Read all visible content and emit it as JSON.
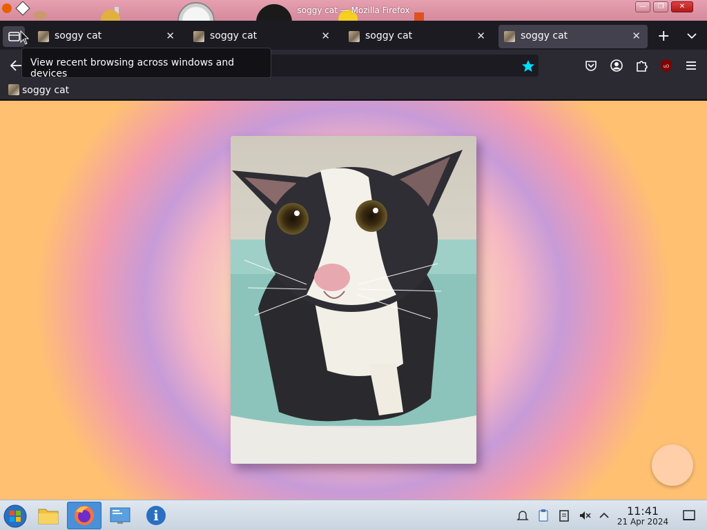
{
  "window": {
    "title": "soggy cat — Mozilla Firefox"
  },
  "tabs": [
    {
      "label": "soggy cat",
      "active": false
    },
    {
      "label": "soggy cat",
      "active": false
    },
    {
      "label": "soggy cat",
      "active": false
    },
    {
      "label": "soggy cat",
      "active": true
    }
  ],
  "tooltip": {
    "text": "View recent browsing across windows and devices"
  },
  "urlbar": {
    "value": ""
  },
  "bookmarks": [
    {
      "label": "soggy cat"
    }
  ],
  "clock": {
    "time": "11:41",
    "date": "21 Apr 2024"
  },
  "colors": {
    "firefox_dark": "#1c1b22",
    "toolbar": "#2b2a33",
    "active_tab": "#42414d",
    "star_accent": "#00ddff",
    "ublock_red": "#800000",
    "titlebar_pink": "#e6a0b0",
    "fab_peach": "#ffcfaa"
  },
  "icons": {
    "tabs_list": "tabs-list-icon",
    "back": "back-arrow-icon",
    "bookmark_star": "star-filled-icon",
    "pocket": "pocket-icon",
    "account": "account-icon",
    "extensions": "puzzle-icon",
    "ublock": "ublock-origin-icon",
    "menu": "hamburger-menu-icon"
  }
}
